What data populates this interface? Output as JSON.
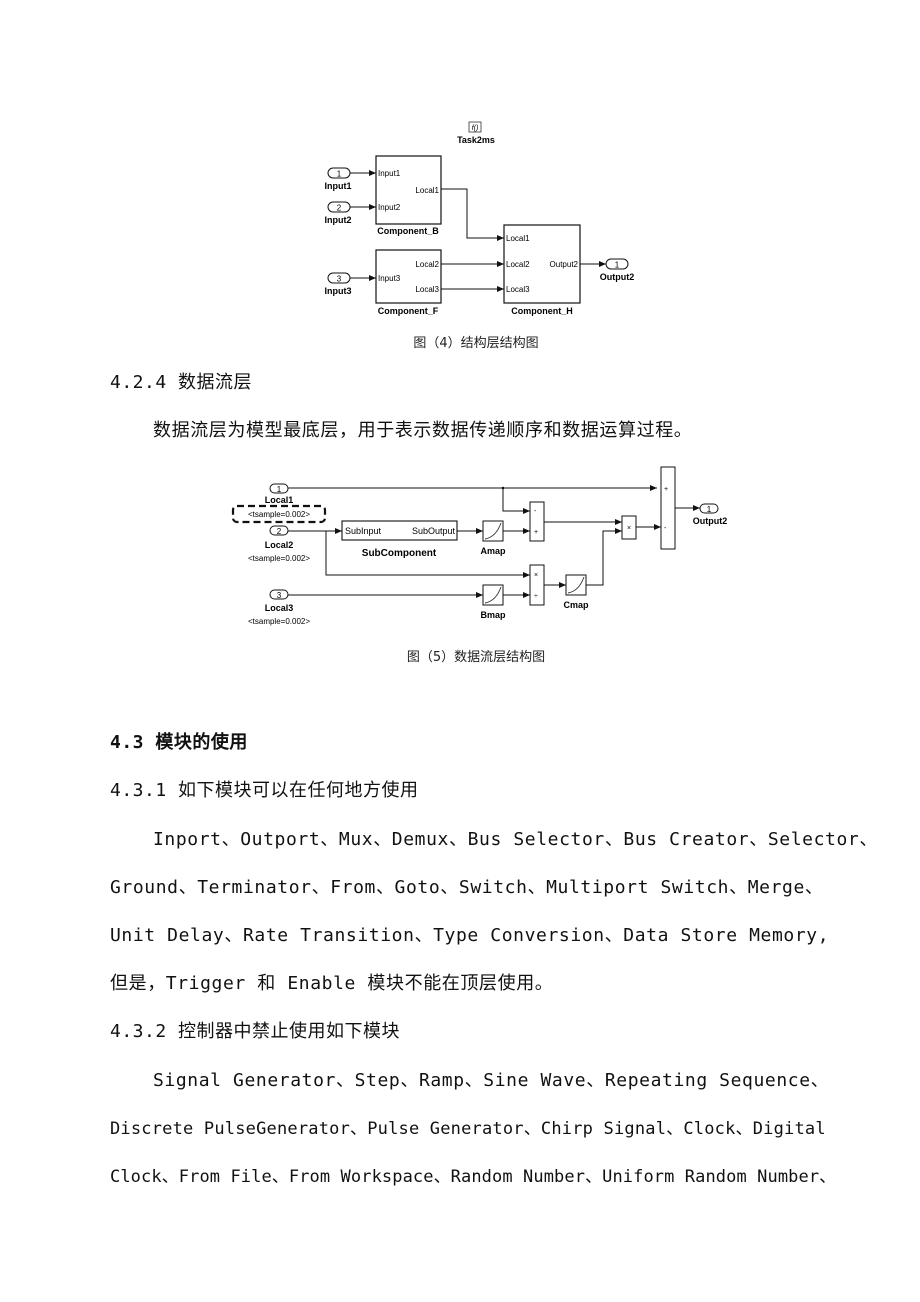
{
  "figure4": {
    "task_block": {
      "icon": "f()",
      "label": "Task2ms"
    },
    "inports": [
      {
        "number": "1",
        "label": "Input1"
      },
      {
        "number": "2",
        "label": "Input2"
      },
      {
        "number": "3",
        "label": "Input3"
      }
    ],
    "component_b": {
      "name": "Component_B",
      "inputs": [
        "Input1",
        "Input2"
      ],
      "outputs": [
        "Local1"
      ]
    },
    "component_f": {
      "name": "Component_F",
      "inputs": [
        "Input3"
      ],
      "outputs": [
        "Local2",
        "Local3"
      ]
    },
    "component_h": {
      "name": "Component_H",
      "inputs": [
        "Local1",
        "Local2",
        "Local3"
      ],
      "outputs": [
        "Output2"
      ]
    },
    "outport": {
      "number": "1",
      "label": "Output2"
    },
    "caption": "图（4）结构层结构图"
  },
  "section_424": {
    "heading": "4.2.4 数据流层",
    "paragraph": "数据流层为模型最底层，用于表示数据传递顺序和数据运算过程。"
  },
  "figure5": {
    "inports": [
      {
        "number": "1",
        "label": "Local1",
        "tsample": "<tsample=0.002>"
      },
      {
        "number": "2",
        "label": "Local2",
        "tsample": "<tsample=0.002>"
      },
      {
        "number": "3",
        "label": "Local3",
        "tsample": "<tsample=0.002>"
      }
    ],
    "subcomponent": {
      "name": "SubComponent",
      "input": "SubInput",
      "output": "SubOutput"
    },
    "lookup_blocks": [
      "Amap",
      "Bmap",
      "Cmap"
    ],
    "sum1_signs": [
      "-",
      "+"
    ],
    "product1_signs": [
      "×",
      "÷"
    ],
    "product2_sign": "×",
    "sum2_signs": [
      "+",
      "-"
    ],
    "outport": {
      "number": "1",
      "label": "Output2"
    },
    "caption": "图（5）数据流层结构图"
  },
  "section_43": {
    "heading": "4.3 模块的使用"
  },
  "section_431": {
    "heading": "4.3.1 如下模块可以在任何地方使用",
    "lines": [
      "Inport、Outport、Mux、Demux、Bus Selector、Bus Creator、Selector、",
      "Ground、Terminator、From、Goto、Switch、Multiport Switch、Merge、",
      "Unit Delay、Rate Transition、Type Conversion、Data Store Memory,",
      "但是，Trigger 和 Enable 模块不能在顶层使用。"
    ]
  },
  "section_432": {
    "heading": "4.3.2 控制器中禁止使用如下模块",
    "lines": [
      "Signal Generator、Step、Ramp、Sine Wave、Repeating Sequence、",
      "Discrete PulseGenerator、Pulse Generator、Chirp Signal、Clock、Digital",
      "Clock、From File、From Workspace、Random Number、Uniform Random Number、"
    ]
  }
}
